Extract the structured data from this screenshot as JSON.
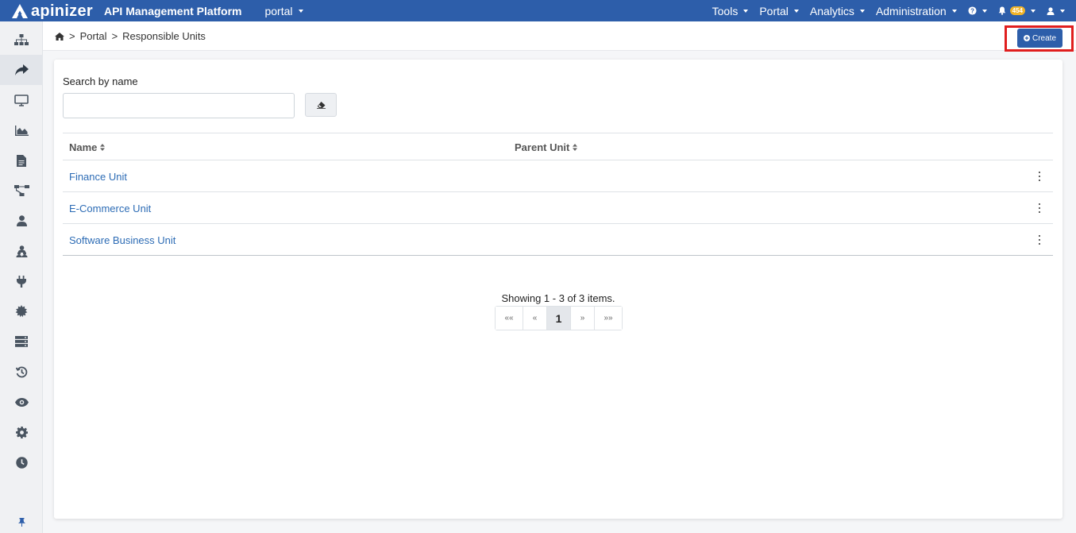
{
  "topbar": {
    "logo_text": "apinizer",
    "platform_title": "API Management Platform",
    "context": "portal",
    "menus": [
      "Tools",
      "Portal",
      "Analytics",
      "Administration"
    ],
    "notification_count": "454",
    "help_icon": "question-circle-icon",
    "bell_icon": "bell-icon",
    "user_icon": "user-icon"
  },
  "sidebar": {
    "items": [
      {
        "icon": "sitemap-icon"
      },
      {
        "icon": "share-arrow-icon",
        "active": true
      },
      {
        "icon": "monitor-icon"
      },
      {
        "icon": "area-chart-icon"
      },
      {
        "icon": "file-icon"
      },
      {
        "icon": "flow-icon"
      },
      {
        "icon": "user-icon"
      },
      {
        "icon": "users-icon"
      },
      {
        "icon": "plug-icon"
      },
      {
        "icon": "gear-burst-icon"
      },
      {
        "icon": "server-icon"
      },
      {
        "icon": "history-icon"
      },
      {
        "icon": "eye-icon"
      },
      {
        "icon": "cog-icon"
      },
      {
        "icon": "clock-icon"
      }
    ],
    "pin_icon": "thumbtack-icon"
  },
  "breadcrumb": {
    "home_icon": "home-icon",
    "items": [
      "Portal",
      "Responsible Units"
    ],
    "separator": ">"
  },
  "actions": {
    "create_label": "Create"
  },
  "search": {
    "label": "Search by name",
    "value": "",
    "placeholder": ""
  },
  "table": {
    "columns": [
      "Name",
      "Parent Unit"
    ],
    "rows": [
      {
        "name": "Finance Unit",
        "parent": ""
      },
      {
        "name": "E-Commerce Unit",
        "parent": ""
      },
      {
        "name": "Software Business Unit",
        "parent": ""
      }
    ]
  },
  "pagination": {
    "summary": "Showing 1 - 3 of 3 items.",
    "first": "««",
    "prev": "«",
    "current": "1",
    "next": "»",
    "last": "»»"
  },
  "colors": {
    "primary": "#2d5eaa",
    "link": "#2d6cb5",
    "highlight": "#e01e1e",
    "badge": "#f0b429"
  }
}
